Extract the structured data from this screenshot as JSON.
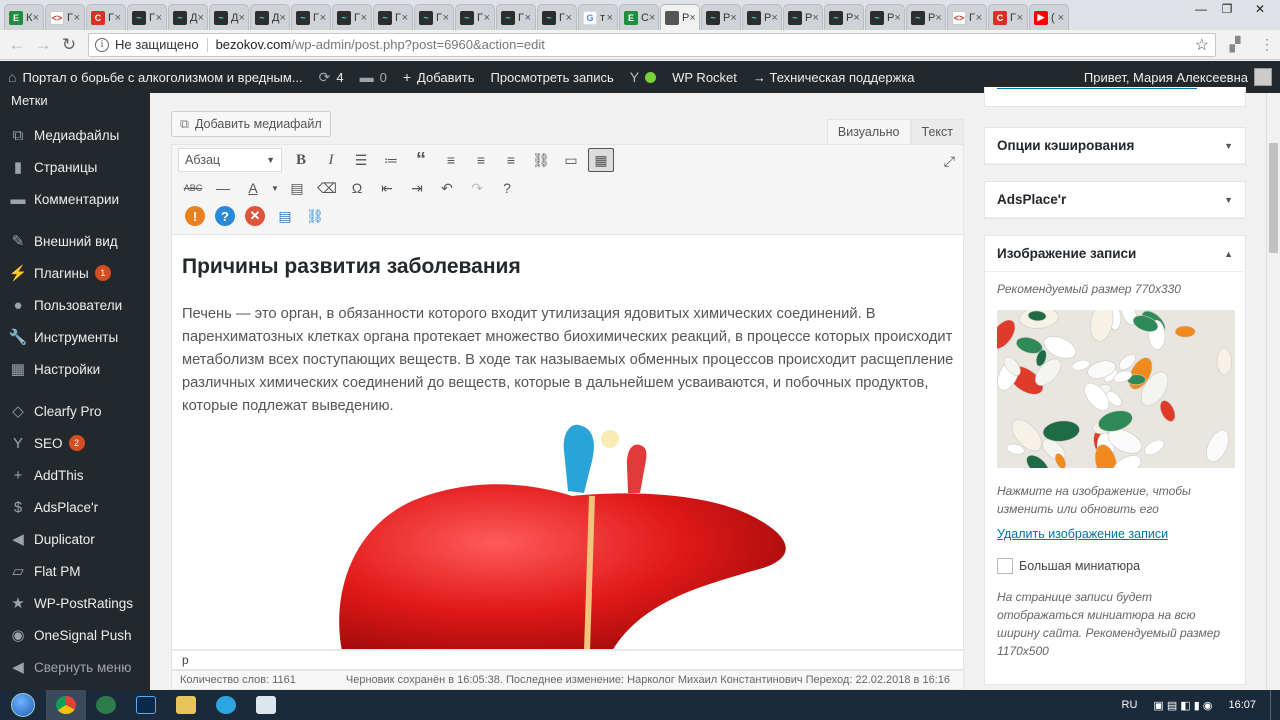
{
  "browser": {
    "tabs": [
      {
        "fav": "green",
        "glyph": "E",
        "label": "К"
      },
      {
        "fav": "code",
        "glyph": "<>",
        "label": "Г"
      },
      {
        "fav": "red",
        "glyph": "C",
        "label": "Г"
      },
      {
        "fav": "dark",
        "glyph": "~",
        "label": "Г"
      },
      {
        "fav": "dark",
        "glyph": "~",
        "label": "Д"
      },
      {
        "fav": "dark",
        "glyph": "~",
        "label": "Д"
      },
      {
        "fav": "dark",
        "glyph": "~",
        "label": "Д"
      },
      {
        "fav": "dark",
        "glyph": "~",
        "label": "Г"
      },
      {
        "fav": "dark",
        "glyph": "~",
        "label": "Г"
      },
      {
        "fav": "dark",
        "glyph": "~",
        "label": "Г"
      },
      {
        "fav": "dark",
        "glyph": "~",
        "label": "Г"
      },
      {
        "fav": "dark",
        "glyph": "~",
        "label": "Г"
      },
      {
        "fav": "dark",
        "glyph": "~",
        "label": "Г"
      },
      {
        "fav": "dark",
        "glyph": "~",
        "label": "Г"
      },
      {
        "fav": "goog",
        "glyph": "G",
        "label": "т"
      },
      {
        "fav": "green",
        "glyph": "E",
        "label": "С"
      },
      {
        "fav": "wp",
        "glyph": "",
        "label": "Р",
        "active": true
      },
      {
        "fav": "dark",
        "glyph": "~",
        "label": "Р"
      },
      {
        "fav": "dark",
        "glyph": "~",
        "label": "Р"
      },
      {
        "fav": "dark",
        "glyph": "~",
        "label": "Р"
      },
      {
        "fav": "dark",
        "glyph": "~",
        "label": "Р"
      },
      {
        "fav": "dark",
        "glyph": "~",
        "label": "Р"
      },
      {
        "fav": "dark",
        "glyph": "~",
        "label": "Р"
      },
      {
        "fav": "code",
        "glyph": "<>",
        "label": "Г"
      },
      {
        "fav": "red",
        "glyph": "C",
        "label": "Г"
      },
      {
        "fav": "yt",
        "glyph": "▶",
        "label": "("
      }
    ],
    "url": {
      "not_secure": "Не защищено",
      "domain": "bezokov.com",
      "path": "/wp-admin/post.php?post=6960&action=edit"
    }
  },
  "adminbar": {
    "site": "Портал о борьбе с алкоголизмом и вредным...",
    "updates": "4",
    "comments": "0",
    "add": "Добавить",
    "view": "Просмотреть запись",
    "rocket": "WP Rocket",
    "support": "→ Техническая поддержка",
    "greeting": "Привет, Мария Алексеевна"
  },
  "menu": {
    "top": "Метки",
    "items": [
      {
        "icon": "media-icon",
        "glyph": "⧉",
        "label": "Медиафайлы"
      },
      {
        "icon": "pages-icon",
        "glyph": "▮",
        "label": "Страницы"
      },
      {
        "icon": "comments-icon",
        "glyph": "▬",
        "label": "Комментарии"
      },
      {
        "icon": "appearance-icon",
        "glyph": "✎",
        "label": "Внешний вид",
        "gap": true
      },
      {
        "icon": "plugins-icon",
        "glyph": "⚡",
        "label": "Плагины",
        "badge": "1"
      },
      {
        "icon": "users-icon",
        "glyph": "●",
        "label": "Пользователи"
      },
      {
        "icon": "tools-icon",
        "glyph": "🔧",
        "label": "Инструменты"
      },
      {
        "icon": "settings-icon",
        "glyph": "▦",
        "label": "Настройки"
      },
      {
        "icon": "clearfy-icon",
        "glyph": "◇",
        "label": "Clearfy Pro",
        "gap": true
      },
      {
        "icon": "seo-icon",
        "glyph": "Y",
        "label": "SEO",
        "badge": "2"
      },
      {
        "icon": "addthis-icon",
        "glyph": "+",
        "label": "AddThis"
      },
      {
        "icon": "adsplacer-icon",
        "glyph": "$",
        "label": "AdsPlace'r"
      },
      {
        "icon": "duplicator-icon",
        "glyph": "◀",
        "label": "Duplicator"
      },
      {
        "icon": "flatpm-icon",
        "glyph": "▱",
        "label": "Flat PM"
      },
      {
        "icon": "postratings-icon",
        "glyph": "★",
        "label": "WP-PostRatings"
      },
      {
        "icon": "onesignal-icon",
        "glyph": "◉",
        "label": "OneSignal Push"
      },
      {
        "icon": "collapse-icon",
        "glyph": "◀",
        "label": "Свернуть меню"
      }
    ]
  },
  "editor": {
    "add_media": "Добавить медиафайл",
    "tab_visual": "Визуально",
    "tab_text": "Текст",
    "format": "Абзац",
    "heading": "Причины развития заболевания",
    "paragraph": "Печень — это орган, в обязанности которого входит утилизация ядовитых химических соединений. В паренхиматозных клетках органа протекает множество биохимических реакций, в процессе которых происходит метаболизм всех поступающих веществ. В ходе так называемых обменных процессов происходит расщепление различных химических соединений до веществ, которые в дальнейшем усваиваются, и побочных продуктов, которые подлежат выведению.",
    "path": "p",
    "word_count": "Количество слов: 1161",
    "draft_status": "Черновик сохранён в 16:05:38. Последнее изменение: Нарколог Михаил Константинович Переход: 22.02.2018 в 16:16"
  },
  "sidebar": {
    "cache_title": "Опции кэширования",
    "ads_title": "AdsPlace'r",
    "featured_title": "Изображение записи",
    "recommended": "Рекомендуемый размер 770x330",
    "click_note": "Нажмите на изображение, чтобы изменить или обновить его",
    "remove_link": "Удалить изображение записи",
    "big_thumb": "Большая миниатюра",
    "big_note": "На странице записи будет отображаться миниатюра на всю ширину сайта. Рекомендуемый размер 1170x500"
  },
  "taskbar": {
    "lang": "RU",
    "time": "16:07"
  },
  "colors": {
    "admin_dark": "#23282d",
    "link": "#0073aa",
    "badge": "#d54e21"
  }
}
